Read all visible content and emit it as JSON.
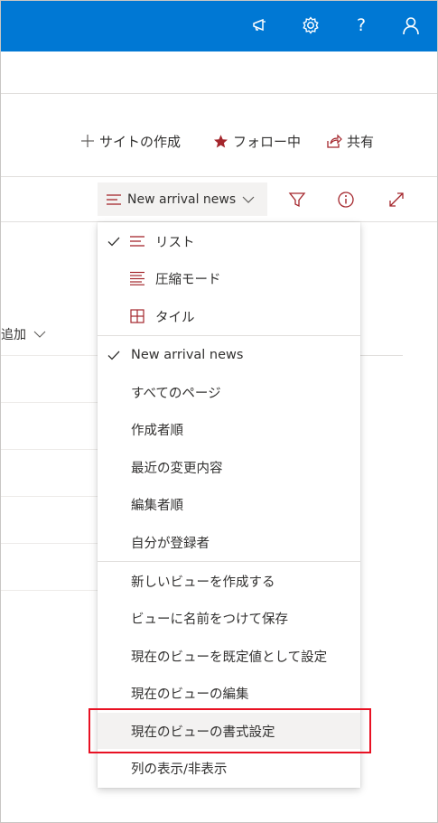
{
  "topbar": {
    "icons": [
      "megaphone-icon",
      "gear-icon",
      "help-icon",
      "person-icon"
    ],
    "help_label": "?",
    "accent": "#0078d4"
  },
  "site_actions": {
    "create_site": "サイトの作成",
    "following": "フォロー中",
    "share": "共有"
  },
  "command_bar": {
    "view_label": "New arrival news",
    "icons": [
      "filter-icon",
      "info-icon",
      "expand-icon"
    ]
  },
  "list": {
    "column_header": "追加"
  },
  "view_menu": {
    "layouts": [
      {
        "label": "リスト",
        "checked": true,
        "icon": "list-icon"
      },
      {
        "label": "圧縮モード",
        "checked": false,
        "icon": "compact-list-icon"
      },
      {
        "label": "タイル",
        "checked": false,
        "icon": "tiles-icon"
      }
    ],
    "views": [
      {
        "label": "New arrival news",
        "checked": true
      },
      {
        "label": "すべてのページ",
        "checked": false
      },
      {
        "label": "作成者順",
        "checked": false
      },
      {
        "label": "最近の変更内容",
        "checked": false
      },
      {
        "label": "編集者順",
        "checked": false
      },
      {
        "label": "自分が登録者",
        "checked": false
      }
    ],
    "actions": [
      {
        "label": "新しいビューを作成する"
      },
      {
        "label": "ビューに名前をつけて保存"
      },
      {
        "label": "現在のビューを既定値として設定"
      },
      {
        "label": "現在のビューの編集"
      },
      {
        "label": "現在のビューの書式設定",
        "highlighted": true
      },
      {
        "label": "列の表示/非表示"
      }
    ],
    "icon_color": "#a4262c"
  }
}
